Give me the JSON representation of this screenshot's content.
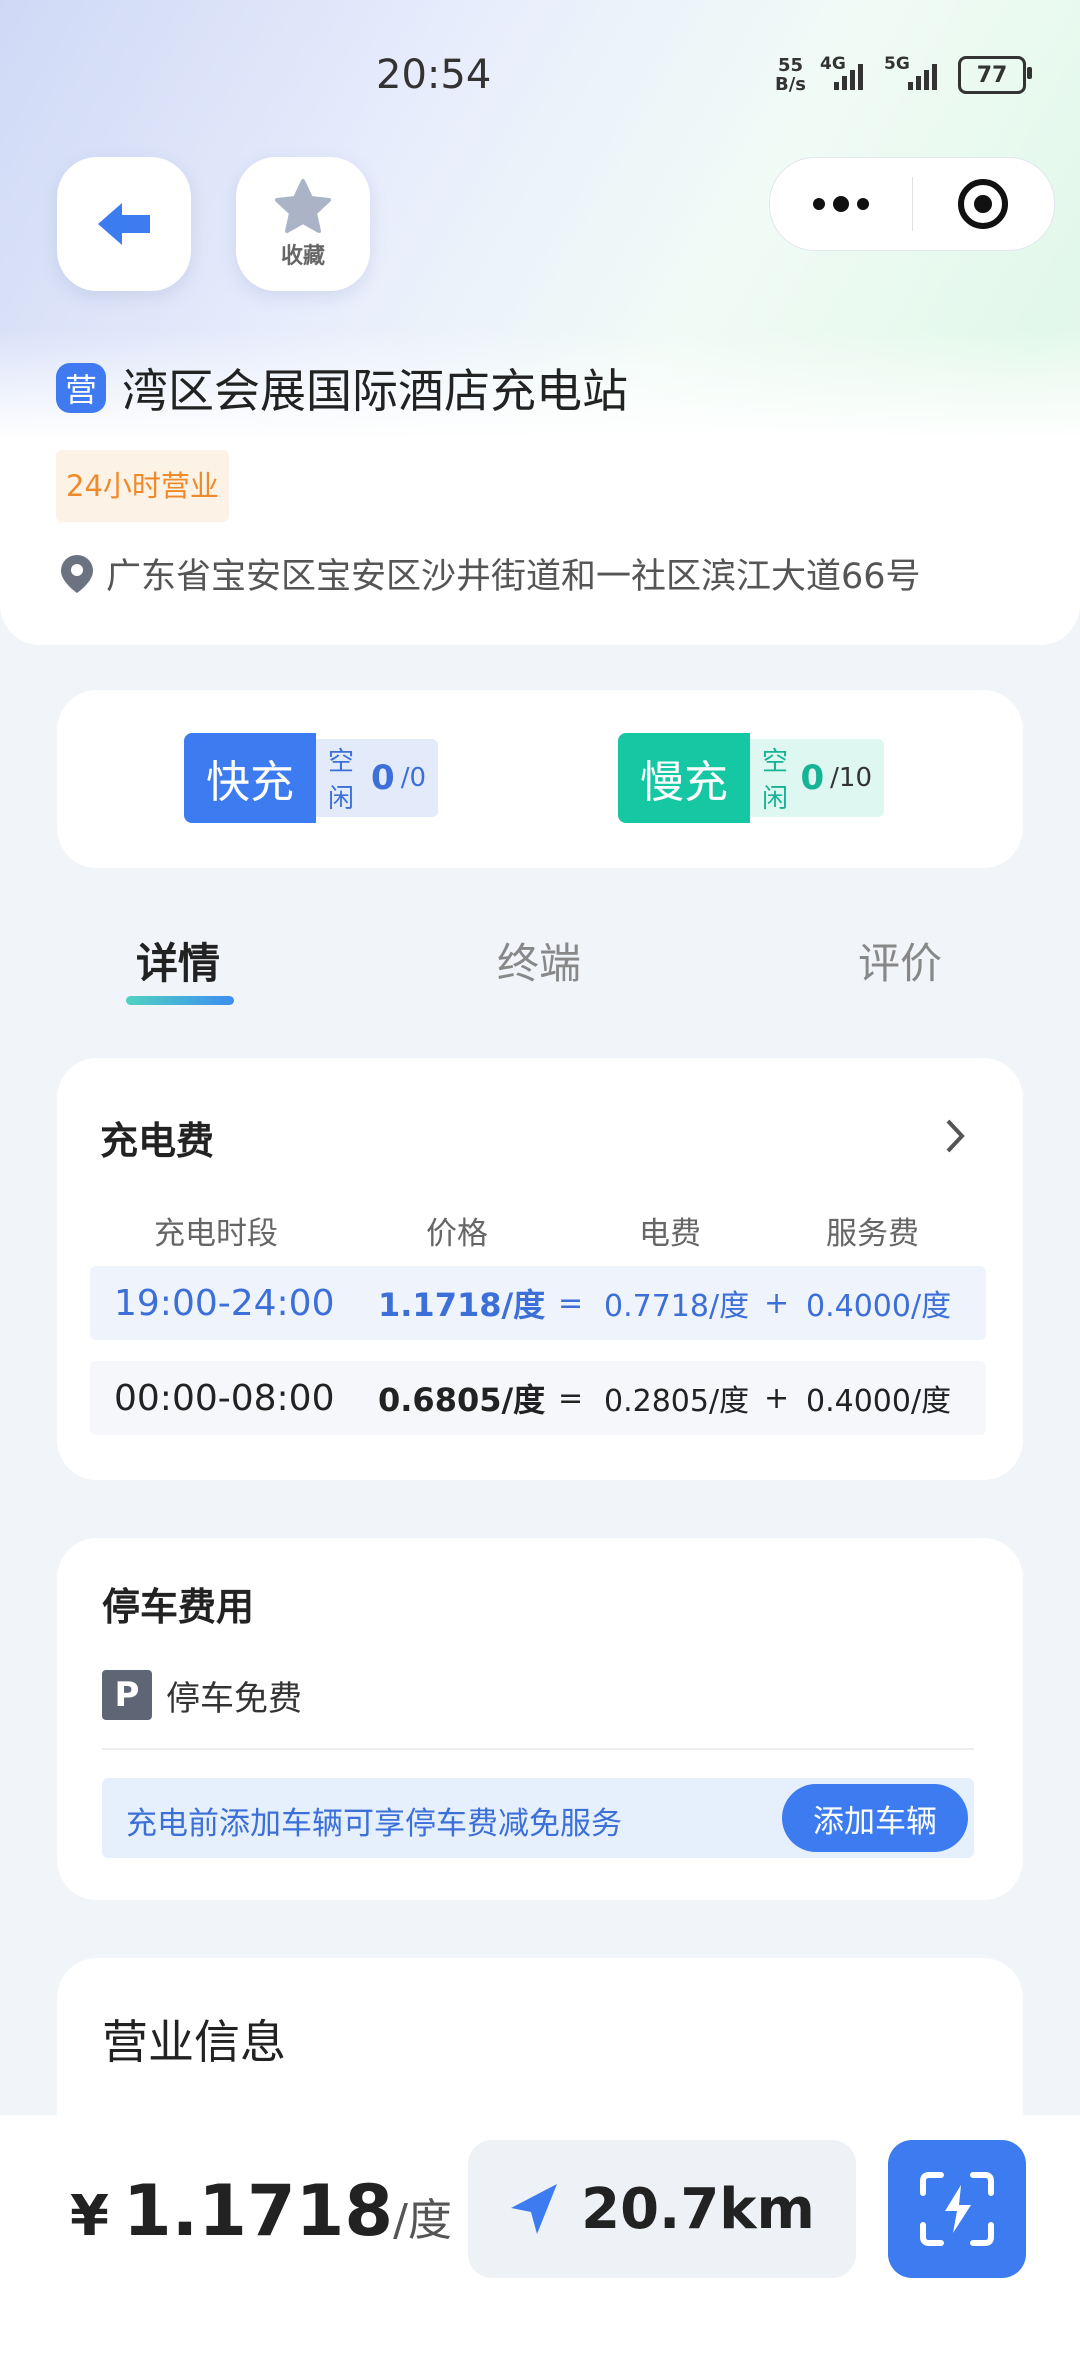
{
  "status_bar": {
    "time": "20:54",
    "net_speed_value": "55",
    "net_speed_unit": "B/s",
    "signal_1": "4G",
    "signal_2": "5G",
    "battery": "77"
  },
  "header": {
    "favorite_label": "收藏",
    "station_badge": "营",
    "station_name": "湾区会展国际酒店充电站",
    "hours_badge": "24小时营业",
    "address": "广东省宝安区宝安区沙井街道和一社区滨江大道66号"
  },
  "charge_types": {
    "fast": {
      "label": "快充",
      "status": "空闲",
      "available": "0",
      "total": "/0"
    },
    "slow": {
      "label": "慢充",
      "status": "空闲",
      "available": "0",
      "total": "/10"
    }
  },
  "tabs": [
    {
      "label": "详情",
      "active": true
    },
    {
      "label": "终端",
      "active": false
    },
    {
      "label": "评价",
      "active": false
    }
  ],
  "fees": {
    "title": "充电费",
    "columns": [
      "充电时段",
      "价格",
      "电费",
      "服务费"
    ],
    "rows": [
      {
        "time": "19:00-24:00",
        "price": "1.1718/度",
        "eq": "=",
        "electricity": "0.7718/度",
        "plus": "+",
        "service": "0.4000/度",
        "current": true
      },
      {
        "time": "00:00-08:00",
        "price": "0.6805/度",
        "eq": "=",
        "electricity": "0.2805/度",
        "plus": "+",
        "service": "0.4000/度",
        "current": false
      }
    ]
  },
  "parking": {
    "title": "停车费用",
    "p_icon": "P",
    "text": "停车免费",
    "promo": "充电前添加车辆可享停车费减免服务",
    "button": "添加车辆"
  },
  "business": {
    "title": "营业信息"
  },
  "bottom": {
    "currency": "¥",
    "price": "1.1718",
    "unit": "/度",
    "distance": "20.7km"
  },
  "colors": {
    "fast_accent": "#3c7cf0",
    "slow_accent": "#16c7a3",
    "price_highlight": "#3c6fd8",
    "hours_badge": "#ef8a2b"
  }
}
